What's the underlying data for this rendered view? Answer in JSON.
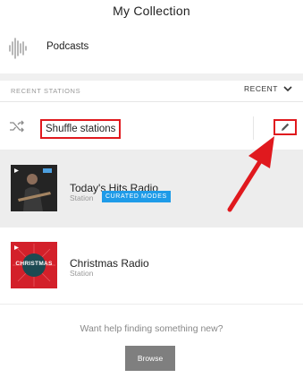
{
  "header": {
    "title": "My Collection"
  },
  "podcasts": {
    "label": "Podcasts",
    "icon": "audio-wave-icon"
  },
  "recent": {
    "section_label": "RECENT STATIONS",
    "sort_label": "RECENT"
  },
  "shuffle": {
    "label": "Shuffle stations",
    "icon": "shuffle-icon",
    "edit_icon": "pencil-icon"
  },
  "stations": [
    {
      "name": "Today's Hits Radio",
      "subtitle": "Station",
      "badge": "CURATED MODES"
    },
    {
      "name": "Christmas Radio",
      "subtitle": "Station",
      "art_text": "CHRISTMAS"
    }
  ],
  "help": {
    "text": "Want help finding something new?",
    "button": "Browse"
  },
  "colors": {
    "annotation_red": "#e0191e",
    "badge_blue": "#1e9be8",
    "button_gray": "#7f7f7f"
  }
}
